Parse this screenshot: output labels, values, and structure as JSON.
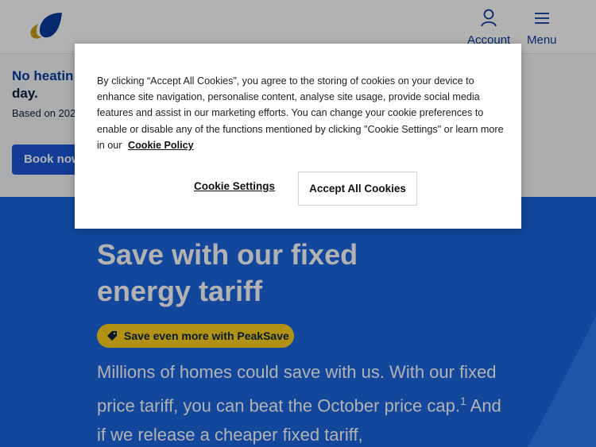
{
  "header": {
    "logo_icon": "leaf-flame-logo",
    "account_label": "Account",
    "account_icon": "user-icon",
    "menu_label": "Menu",
    "menu_icon": "hamburger-icon"
  },
  "promo": {
    "heading_line1": "No heatin",
    "heading_line2": "day.",
    "subtext": "Based on 202",
    "button_label": "Book now"
  },
  "hero": {
    "title": "Save with our fixed energy tariff",
    "pill_label": "Save even more with PeakSave",
    "pill_icon": "tag-icon",
    "body_part1": "Millions of homes could save with us. With our fixed price tariff, you can beat the October price cap.",
    "body_sup": "1",
    "body_part2": " And if we release a cheaper fixed tariff,"
  },
  "cookie_banner": {
    "text": "By clicking “Accept All Cookies”, you agree to the storing of cookies on your device to enhance site navigation, personalise content, analyse site usage, provide social media features and assist in our marketing efforts. You can change your cookie preferences to enable or disable any of the functions mentioned by clicking \"Cookie Settings\" or learn more in our",
    "policy_link": "Cookie Policy",
    "settings_button": "Cookie Settings",
    "accept_button": "Accept All Cookies"
  },
  "colors": {
    "brand_blue": "#1a66e0",
    "button_blue": "#1a57d6",
    "dark_navy": "#0c2340",
    "pill_yellow": "#ffd21f",
    "logo_gold": "#c8a020"
  }
}
